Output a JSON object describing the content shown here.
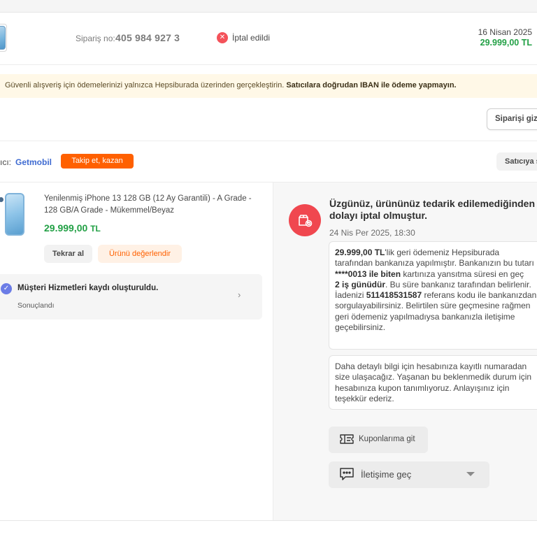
{
  "order": {
    "number_label": "Sipariş no:",
    "number": "405 984 927 3",
    "status": "İptal edildi",
    "date": "16 Nisan 2025",
    "total": "29.999,00 TL"
  },
  "warning": {
    "text": "Güvenli alışveriş için ödemelerinizi yalnızca Hepsiburada üzerinden gerçekleştirin. ",
    "bold": "Satıcılara doğrudan IBAN ile ödeme yapmayın."
  },
  "actions": {
    "hide_order": "Siparişi gizl"
  },
  "seller": {
    "label": "ıcı:",
    "name": "Getmobil",
    "follow_button": "Takip et, kazan",
    "contact_button": "Satıcıya s"
  },
  "product": {
    "title": "Yenilenmiş iPhone 13 128 GB (12 Ay Garantili) - A Grade - 128 GB/A Grade - Mükemmel/Beyaz",
    "price": "29.999,00",
    "currency": "TL",
    "reorder_button": "Tekrar al",
    "review_button": "Ürünü değerlendir"
  },
  "ticket": {
    "title": "Müşteri Hizmetleri kaydı oluşturuldu.",
    "status": "Sonuçlandı"
  },
  "cancellation": {
    "heading": "Üzgünüz, ürününüz tedarik edilemediğinden dolayı iptal olmuştur.",
    "date": "24 Nis Per 2025, 18:30",
    "msg1": {
      "amount": "29.999,00 TL",
      "l1_rest": "'lik geri ödemeniz Hepsiburada",
      "l2": "tarafından bankanıza yapılmıştır. Bankanızın bu tutarı",
      "card": "****0013 ile biten",
      "l3_rest": " kartınıza yansıtma süresi en geç",
      "days": "2 iş günüdür",
      "l4_rest": ". Bu süre bankanız tarafından belirlenir.",
      "l5_pre": "İadenizi ",
      "ref": "511418531587",
      "l5_rest": " referans kodu ile bankanızdan",
      "l6": "sorgulayabilirsiniz. Belirtilen süre geçmesine rağmen",
      "l7": "geri ödemeniz yapılmadıysa bankanızla iletişime",
      "l8": "geçebilirsiniz."
    },
    "msg2": {
      "l1": "Daha detaylı bilgi için hesabınıza kayıtlı numaradan",
      "l2": "size ulaşacağız. Yaşanan bu beklenmedik durum için",
      "l3": "hesabınıza kupon tanımlıyoruz. Anlayışınız için",
      "l4": "teşekkür ederiz."
    },
    "coupon_button": "Kuponlarıma git",
    "contact_button": "İletişime geç"
  },
  "colors": {
    "brand_orange": "#ff6000",
    "price_green": "#22a045",
    "cancel_red": "#f0474f",
    "seller_blue": "#3f6bd1"
  }
}
